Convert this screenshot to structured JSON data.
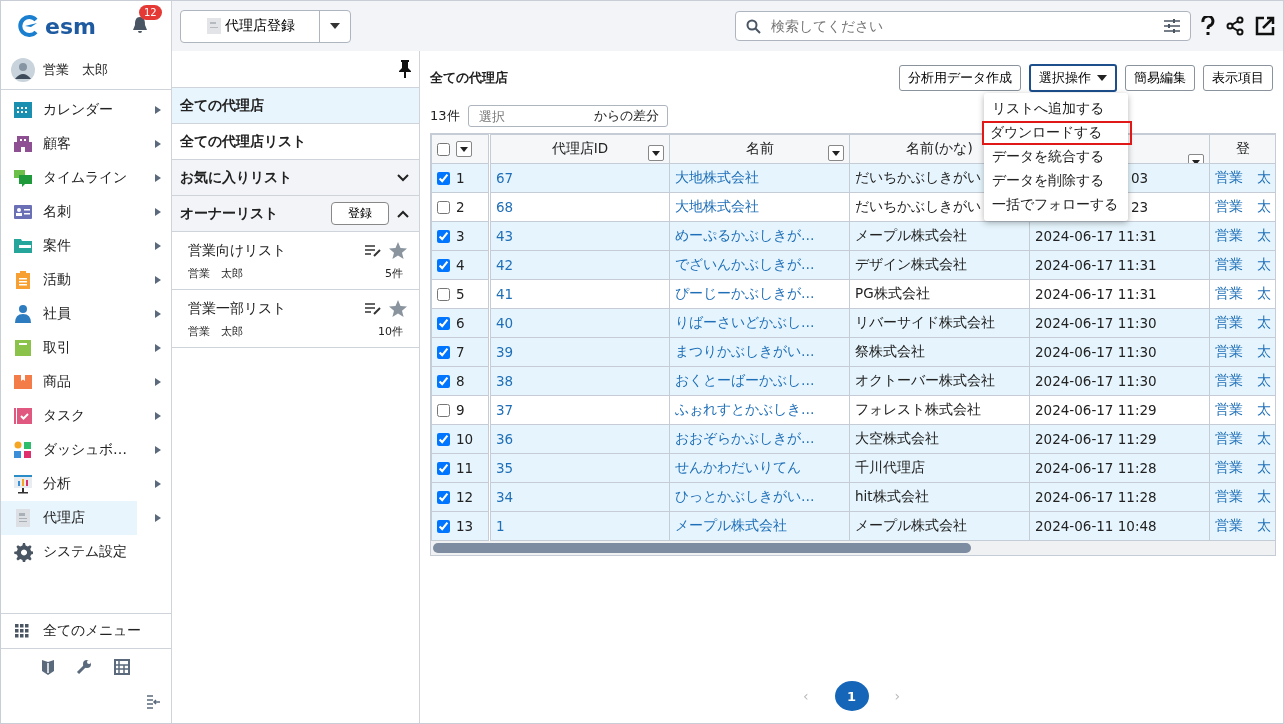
{
  "app": {
    "logo": "esm",
    "notifications": "12",
    "user": "営業　太郎"
  },
  "sidebar": {
    "items": [
      {
        "label": "カレンダー",
        "submenu": true,
        "selected": false
      },
      {
        "label": "顧客",
        "submenu": true,
        "selected": false
      },
      {
        "label": "タイムライン",
        "submenu": true,
        "selected": false
      },
      {
        "label": "名刺",
        "submenu": true,
        "selected": false
      },
      {
        "label": "案件",
        "submenu": true,
        "selected": false
      },
      {
        "label": "活動",
        "submenu": true,
        "selected": false
      },
      {
        "label": "社員",
        "submenu": true,
        "selected": false
      },
      {
        "label": "取引",
        "submenu": true,
        "selected": false
      },
      {
        "label": "商品",
        "submenu": true,
        "selected": false
      },
      {
        "label": "タスク",
        "submenu": true,
        "selected": false
      },
      {
        "label": "ダッシュボ…",
        "submenu": true,
        "selected": false
      },
      {
        "label": "分析",
        "submenu": true,
        "selected": false
      },
      {
        "label": "代理店",
        "submenu": true,
        "selected": true
      },
      {
        "label": "システム設定",
        "submenu": false,
        "selected": false
      }
    ],
    "all_menu": "全てのメニュー"
  },
  "toolbar": {
    "register_button": "代理店登録",
    "search": {
      "placeholder": "検索してください"
    }
  },
  "list_panel": {
    "views": [
      {
        "label": "全ての代理店",
        "selected": true
      },
      {
        "label": "全ての代理店リスト",
        "selected": false
      }
    ],
    "sections": [
      {
        "label": "お気に入りリスト",
        "expanded": false
      },
      {
        "label": "オーナーリスト",
        "expanded": true,
        "button": "登録"
      }
    ],
    "lists": [
      {
        "name": "営業向けリスト",
        "owner": "営業　太郎",
        "count": "5件"
      },
      {
        "name": "営業一部リスト",
        "owner": "営業　太郎",
        "count": "10件"
      }
    ]
  },
  "main": {
    "title": "全ての代理店",
    "buttons": [
      "分析用データ作成",
      "選択操作",
      "簡易編集",
      "表示項目"
    ],
    "count": "13件",
    "diff": {
      "placeholder": "選択",
      "suffix": "からの差分"
    },
    "menu": [
      {
        "label": "リストへ追加する",
        "highlighted": false
      },
      {
        "label": "ダウンロードする",
        "highlighted": true
      },
      {
        "label": "データを統合する",
        "highlighted": false
      },
      {
        "label": "データを削除する",
        "highlighted": false
      },
      {
        "label": "一括でフォローする",
        "highlighted": false
      }
    ],
    "table": {
      "all_checked": false,
      "columns": [
        {
          "label": "代理店ID",
          "filter": true
        },
        {
          "label": "名前",
          "filter": true
        },
        {
          "label": "名前(かな)",
          "filter": false
        },
        {
          "filter": true
        },
        {
          "label": "登",
          "filter": false
        }
      ],
      "rows": [
        {
          "checked": true,
          "no": "1",
          "cells": [
            "67",
            "大地株式会社",
            "だいちかぶしきがい",
            "03",
            "営業　太"
          ]
        },
        {
          "checked": false,
          "no": "2",
          "cells": [
            "68",
            "大地株式会社",
            "だいちかぶしきがい",
            "23",
            "営業　太"
          ]
        },
        {
          "checked": true,
          "no": "3",
          "cells": [
            "43",
            "めーぷるかぶしきが…",
            "メープル株式会社",
            "2024-06-17 11:31",
            "営業　太"
          ]
        },
        {
          "checked": true,
          "no": "4",
          "cells": [
            "42",
            "でざいんかぶしきが…",
            "デザイン株式会社",
            "2024-06-17 11:31",
            "営業　太"
          ]
        },
        {
          "checked": false,
          "no": "5",
          "cells": [
            "41",
            "ぴーじーかぶしきが…",
            "PG株式会社",
            "2024-06-17 11:31",
            "営業　太"
          ]
        },
        {
          "checked": true,
          "no": "6",
          "cells": [
            "40",
            "りばーさいどかぶし…",
            "リバーサイド株式会社",
            "2024-06-17 11:30",
            "営業　太"
          ]
        },
        {
          "checked": true,
          "no": "7",
          "cells": [
            "39",
            "まつりかぶしきがい…",
            "祭株式会社",
            "2024-06-17 11:30",
            "営業　太"
          ]
        },
        {
          "checked": true,
          "no": "8",
          "cells": [
            "38",
            "おくとーばーかぶし…",
            "オクトーバー株式会社",
            "2024-06-17 11:30",
            "営業　太"
          ]
        },
        {
          "checked": false,
          "no": "9",
          "cells": [
            "37",
            "ふぉれすとかぶしき…",
            "フォレスト株式会社",
            "2024-06-17 11:29",
            "営業　太"
          ]
        },
        {
          "checked": true,
          "no": "10",
          "cells": [
            "36",
            "おおぞらかぶしきが…",
            "大空株式会社",
            "2024-06-17 11:29",
            "営業　太"
          ]
        },
        {
          "checked": true,
          "no": "11",
          "cells": [
            "35",
            "せんかわだいりてん",
            "千川代理店",
            "2024-06-17 11:28",
            "営業　太"
          ]
        },
        {
          "checked": true,
          "no": "12",
          "cells": [
            "34",
            "ひっとかぶしきがい…",
            "hit株式会社",
            "2024-06-17 11:28",
            "営業　太"
          ]
        },
        {
          "checked": true,
          "no": "13",
          "cells": [
            "1",
            "メープル株式会社",
            "メープル株式会社",
            "2024-06-11 10:48",
            "営業　太"
          ]
        }
      ]
    },
    "pagination": [
      {
        "label": "1",
        "selected": true
      }
    ],
    "prev": "‹",
    "next": "›"
  }
}
